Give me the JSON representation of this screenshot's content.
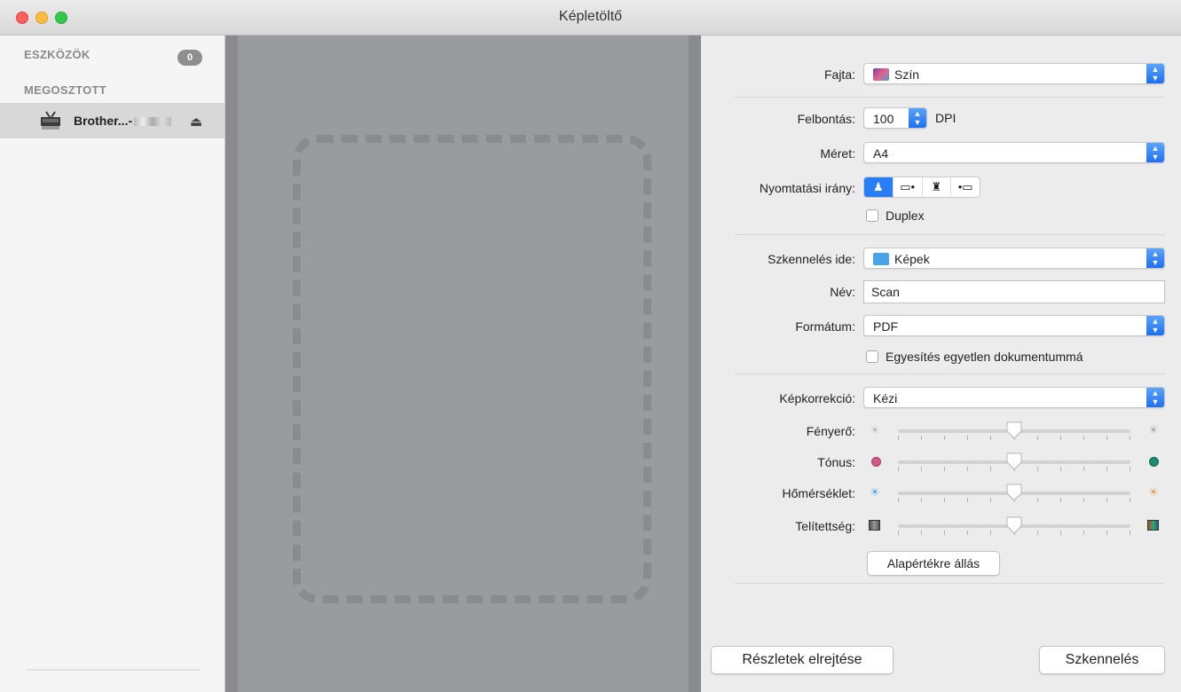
{
  "window": {
    "title": "Képletöltő"
  },
  "sidebar": {
    "devices_header": "ESZKÖZÖK",
    "devices_count": "0",
    "shared_header": "MEGOSZTOTT",
    "device": {
      "name": "Brother...-",
      "icon": "scanner-icon",
      "eject_icon": "eject-icon"
    }
  },
  "panel": {
    "kind": {
      "label": "Fajta:",
      "value": "Szín"
    },
    "resolution": {
      "label": "Felbontás:",
      "value": "100",
      "unit": "DPI"
    },
    "size": {
      "label": "Méret:",
      "value": "A4"
    },
    "orientation": {
      "label": "Nyomtatási irány:",
      "options": [
        "portrait",
        "landscape-left",
        "upside-down",
        "landscape-right"
      ],
      "selected": 0
    },
    "duplex": {
      "label": "Duplex",
      "checked": false
    },
    "scan_to": {
      "label": "Szkennelés ide:",
      "value": "Képek"
    },
    "name": {
      "label": "Név:",
      "value": "Scan"
    },
    "format": {
      "label": "Formátum:",
      "value": "PDF"
    },
    "combine": {
      "label": "Egyesítés egyetlen dokumentummá",
      "checked": false
    },
    "correction": {
      "label": "Képkorrekció:",
      "value": "Kézi"
    },
    "sliders": [
      {
        "label": "Fényerő:",
        "value": 0.5,
        "left_icon": "sun-dim-icon",
        "right_icon": "sun-bright-icon"
      },
      {
        "label": "Tónus:",
        "value": 0.5,
        "left_icon": "pink-dot-icon",
        "right_icon": "green-dot-icon"
      },
      {
        "label": "Hőmérséklet:",
        "value": 0.5,
        "left_icon": "cool-sun-icon",
        "right_icon": "warm-sun-icon"
      },
      {
        "label": "Telítettség:",
        "value": 0.5,
        "left_icon": "gray-square-icon",
        "right_icon": "color-square-icon"
      }
    ],
    "reset_button": "Alapértékre állás",
    "hide_details_button": "Részletek elrejtése",
    "scan_button": "Szkennelés"
  },
  "colors": {
    "accent": "#2a7ef5",
    "preview_bg": "#9a9b9e"
  }
}
